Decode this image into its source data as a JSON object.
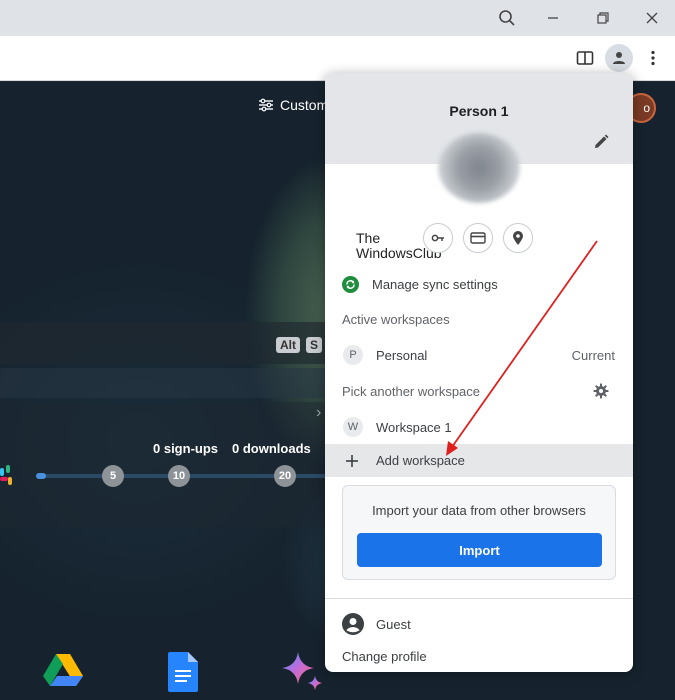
{
  "browser": {
    "titlebar": {
      "search_icon": "search-icon",
      "minimize_icon": "minimize-icon",
      "restore_icon": "restore-icon",
      "close_icon": "close-icon"
    },
    "toolbar": {
      "split_view_icon": "split-view-icon",
      "profile_icon": "person-icon",
      "menu_icon": "more-vert-icon"
    }
  },
  "background": {
    "customize_label": "Custom",
    "shortcut_keys": [
      "Alt",
      "S"
    ],
    "stats": {
      "signups": "0 sign-ups",
      "downloads": "0 downloads"
    },
    "milestones": [
      "5",
      "10",
      "20"
    ],
    "avatar_text": "o",
    "colors": {
      "progress_fill": "#4a8fe0",
      "milestone": "#8e9398"
    }
  },
  "profile_menu": {
    "name": "Person 1",
    "watermark_line1": "The",
    "watermark_line2": "WindowsClub",
    "sync_label": "Manage sync settings",
    "active_workspaces_label": "Active workspaces",
    "active_workspaces": [
      {
        "letter": "P",
        "name": "Personal",
        "status": "Current"
      }
    ],
    "pick_workspace_label": "Pick another workspace",
    "other_workspaces": [
      {
        "letter": "W",
        "name": "Workspace 1"
      }
    ],
    "add_workspace_label": "Add workspace",
    "import_text": "Import your data from other browsers",
    "import_button": "Import",
    "guest_label": "Guest",
    "change_profile_label": "Change profile",
    "colors": {
      "import_button": "#1a73e8",
      "sync_icon": "#1e8e3e",
      "annotation_arrow": "#e0201e"
    }
  }
}
